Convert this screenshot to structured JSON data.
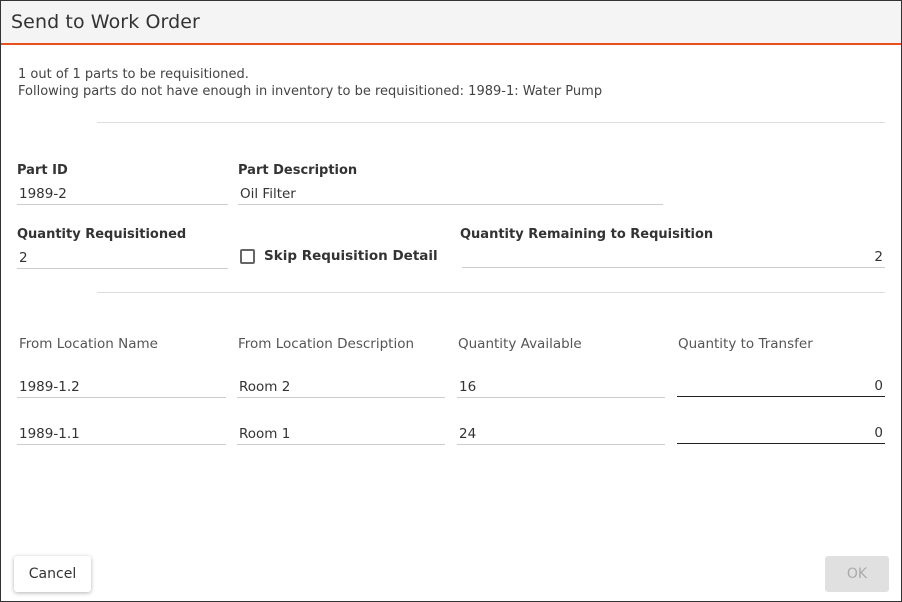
{
  "dialog": {
    "title": "Send to Work Order",
    "messages": [
      "1 out of 1 parts to be requisitioned.",
      "Following parts do not have enough in inventory to be requisitioned: 1989-1: Water Pump"
    ]
  },
  "part": {
    "id_label": "Part ID",
    "id_value": "1989-2",
    "description_label": "Part Description",
    "description_value": "Oil Filter",
    "qty_requisitioned_label": "Quantity Requisitioned",
    "qty_requisitioned_value": "2",
    "skip_detail_label": "Skip Requisition Detail",
    "skip_detail_checked": false,
    "qty_remaining_label": "Quantity Remaining to Requisition",
    "qty_remaining_value": "2"
  },
  "locations": {
    "columns": [
      "From Location Name",
      "From Location Description",
      "Quantity Available",
      "Quantity to Transfer"
    ],
    "rows": [
      {
        "name": "1989-1.2",
        "description": "Room 2",
        "available": "16",
        "transfer": "0"
      },
      {
        "name": "1989-1.1",
        "description": "Room 1",
        "available": "24",
        "transfer": "0"
      }
    ]
  },
  "footer": {
    "cancel_label": "Cancel",
    "ok_label": "OK",
    "ok_disabled": true
  },
  "colors": {
    "accent": "#e8501e",
    "header_bg": "#f4f4f4",
    "disabled_bg": "#e0e0e0"
  }
}
